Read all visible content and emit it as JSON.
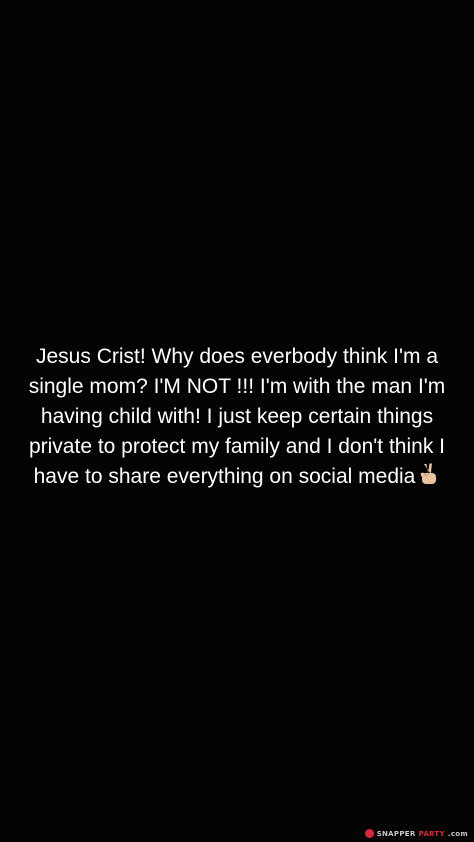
{
  "caption": {
    "lines": [
      "Jesus Crist! Why does everbody think I'm a",
      "single mom? I'M NOT !!! I'm with the man I'm",
      "having child with! I just keep certain things",
      "private to protect my family and I don't think I",
      "have to share everything on social media"
    ],
    "trailing_emoji": "victory-hand-emoji"
  },
  "watermark": {
    "prefix": "SNAPPER",
    "brand": "PARTY",
    "suffix": ".com"
  },
  "colors": {
    "background": "#030303",
    "text": "#ffffff",
    "watermark_accent": "#d6283a"
  }
}
